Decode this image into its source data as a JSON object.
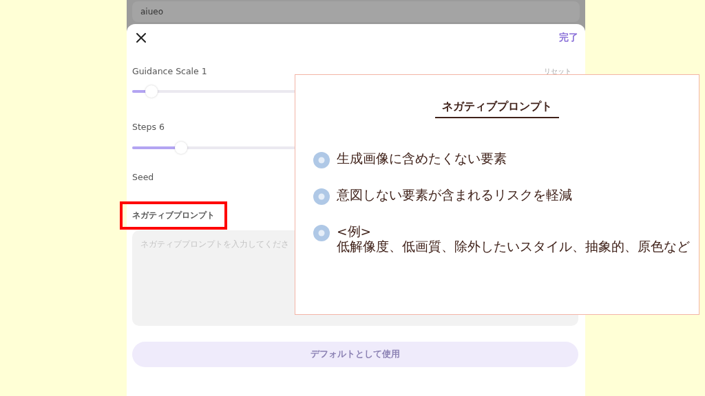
{
  "background_field": {
    "value": "aiueo"
  },
  "header": {
    "done": "完了"
  },
  "sliders": [
    {
      "label": "Guidance Scale 1",
      "reset": "リセット",
      "level": 0.043
    },
    {
      "label": "Steps 6",
      "level": 0.11
    }
  ],
  "seed": {
    "label": "Seed"
  },
  "negative_prompt": {
    "label": "ネガティブプロンプト",
    "highlighted": true,
    "placeholder": "ネガティブプロンプトを入力してくださ"
  },
  "default_button": "デフォルトとして使用",
  "callout": {
    "title": "ネガティブプロンプト",
    "bullets": [
      {
        "lines": [
          "生成画像に含めたくない要素"
        ]
      },
      {
        "lines": [
          "意図しない要素が含まれるリスクを軽減"
        ]
      },
      {
        "lines": [
          "<例>",
          "低解像度、低画質、除外したいスタイル、抽象的、原色など"
        ]
      }
    ]
  }
}
